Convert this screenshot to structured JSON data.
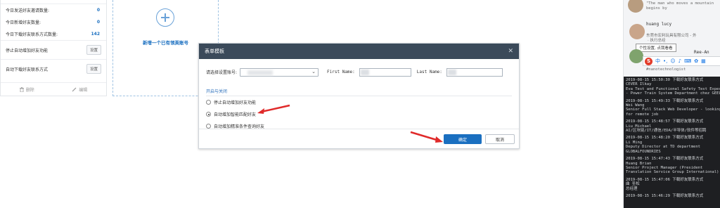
{
  "stats": {
    "rows": [
      {
        "label": "今日发送好友邀请数量:",
        "value": "0"
      },
      {
        "label": "今日新增好友数量:",
        "value": "0"
      },
      {
        "label": "今日下载好友联系方式数量:",
        "value": "142"
      }
    ],
    "settings": [
      {
        "label": "停止自动增加好友功能",
        "button": "设置"
      },
      {
        "label": "自动下载好友联系方式",
        "button": "设置"
      }
    ],
    "footer": {
      "delete": "删除",
      "edit": "编辑"
    }
  },
  "add_card": {
    "label": "新增一个已有领英账号"
  },
  "modal": {
    "title": "表单模板",
    "select_label": "请选择设置账号:",
    "first_name_label": "First Name:",
    "last_name_label": "Last Name:",
    "section_title": "开启与关闭",
    "options": [
      {
        "label": "停止自动增加好友功能",
        "checked": false
      },
      {
        "label": "自动增加智能匹配好友",
        "checked": true
      },
      {
        "label": "自动增加精准条件查询好友",
        "checked": false
      }
    ],
    "ok": "确定",
    "cancel": "取消"
  },
  "right_panel": {
    "quote": "\"The man who moves a mountain begins by",
    "profile_name": "huang lucy",
    "profile_company": "东莞市宏利玩具有限公司 - 外",
    "profile_company2": "· 执行总经",
    "tooltip": "个性设置, 点我看看",
    "partial_name": "Ree-An",
    "partial_sub": "#nanotechnologist",
    "ime_glyph": "中",
    "logs": [
      {
        "ts": "2019-08-15 15:50:30 下载好友联系方式",
        "lines": [
          "CEVER Ilkay",
          "Eva Test and Functional Safety Test Expert",
          "- Power Train System Department chez GEELY"
        ]
      },
      {
        "ts": "2019-08-15 15:49:33 下载好友联系方式",
        "lines": [
          "Wei Wang",
          "Senior Full Stack Web Developer - looking",
          "for remote job"
        ]
      },
      {
        "ts": "2019-08-15 15:48:57 下载好友联系方式",
        "lines": [
          "Liu Michael",
          "AI/区块链/IT/通信/EDA/半导体/软件等招聘"
        ]
      },
      {
        "ts": "2019-08-15 15:48:20 下载好友联系方式",
        "lines": [
          "Li Ming",
          "Deputy Director at TD department",
          "GLOBALFOUNDRIES"
        ]
      },
      {
        "ts": "2019-08-15 15:47:43 下载好友联系方式",
        "lines": [
          "Huang Brian",
          "Senior Project Manager (President",
          "Translation Service Group International)"
        ]
      },
      {
        "ts": "2019-08-15 15:47:06 下载好友联系方式",
        "lines": [
          "曲 圣松",
          "总经理"
        ]
      },
      {
        "ts": "2019-08-15 15:46:29 下载好友联系方式",
        "lines": []
      }
    ]
  },
  "colors": {
    "accent": "#1a6fc0",
    "modal_header": "#3b4a5a",
    "arrow": "#e02a2a"
  }
}
